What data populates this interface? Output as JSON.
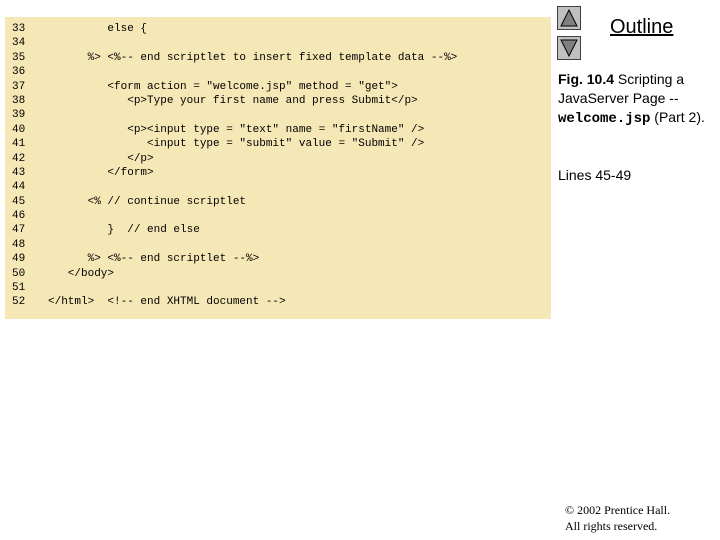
{
  "code": {
    "lines": [
      {
        "num": "33",
        "text": "         else {"
      },
      {
        "num": "34",
        "text": ""
      },
      {
        "num": "35",
        "text": "      %> <%-- end scriptlet to insert fixed template data --%>"
      },
      {
        "num": "36",
        "text": ""
      },
      {
        "num": "37",
        "text": "         <form action = \"welcome.jsp\" method = \"get\">"
      },
      {
        "num": "38",
        "text": "            <p>Type your first name and press Submit</p>"
      },
      {
        "num": "39",
        "text": ""
      },
      {
        "num": "40",
        "text": "            <p><input type = \"text\" name = \"firstName\" />"
      },
      {
        "num": "41",
        "text": "               <input type = \"submit\" value = \"Submit\" />"
      },
      {
        "num": "42",
        "text": "            </p>"
      },
      {
        "num": "43",
        "text": "         </form>"
      },
      {
        "num": "44",
        "text": ""
      },
      {
        "num": "45",
        "text": "      <% // continue scriptlet"
      },
      {
        "num": "46",
        "text": ""
      },
      {
        "num": "47",
        "text": "         }  // end else"
      },
      {
        "num": "48",
        "text": ""
      },
      {
        "num": "49",
        "text": "      %> <%-- end scriptlet --%>"
      },
      {
        "num": "50",
        "text": "   </body>"
      },
      {
        "num": "51",
        "text": ""
      },
      {
        "num": "52",
        "text": "</html>  <!-- end XHTML document -->"
      }
    ]
  },
  "sidebar": {
    "outline_label": "Outline",
    "caption_fig": "Fig. 10.4",
    "caption_text_1": "  Scripting a JavaServer Page -- ",
    "caption_mono": "welcome.jsp",
    "caption_text_2": " (Part 2).",
    "lines_ref": "Lines 45-49"
  },
  "nav": {
    "up_icon": "triangle-up-icon",
    "down_icon": "triangle-down-icon"
  },
  "footer": {
    "copyright_line1": "© 2002 Prentice Hall.",
    "copyright_line2": "All rights reserved."
  }
}
